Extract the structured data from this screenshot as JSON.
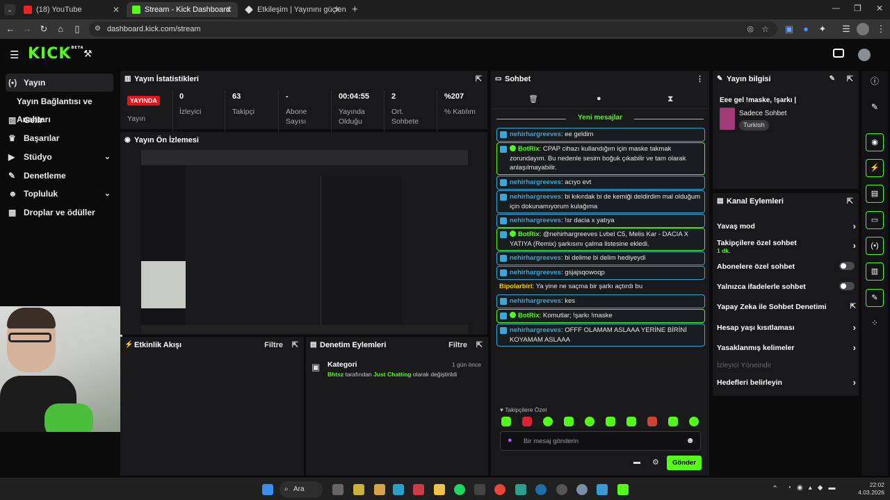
{
  "browser": {
    "tabs": [
      {
        "title": "(18) YouTube"
      },
      {
        "title": "Stream - Kick Dashboard"
      },
      {
        "title": "Etkileşim | Yayınını güçlendi"
      }
    ],
    "url": "dashboard.kick.com/stream",
    "new_tab": "+"
  },
  "kick": {
    "logo": "KICK",
    "logo_beta": "BETA"
  },
  "sidebar": {
    "items": [
      {
        "label": "Yayın",
        "icon": "broadcast-icon"
      },
      {
        "label": "Yayın Bağlantısı ve Anahtarı",
        "icon": ""
      },
      {
        "label": "Gelir",
        "icon": "chart-icon"
      },
      {
        "label": "Başarılar",
        "icon": "trophy-icon"
      },
      {
        "label": "Stüdyo",
        "icon": "video-icon"
      },
      {
        "label": "Denetleme",
        "icon": "wrench-icon"
      },
      {
        "label": "Topluluk",
        "icon": "users-icon"
      },
      {
        "label": "Droplar ve ödüller",
        "icon": "gift-icon"
      }
    ]
  },
  "stats": {
    "title": "Yayın İstatistikleri",
    "live_badge": "YAYINDA",
    "live_label": "Yayın",
    "items": [
      {
        "value": "0",
        "label": "İzleyici"
      },
      {
        "value": "63",
        "label": "Takipçi"
      },
      {
        "value": "-",
        "label": "Abone Sayısı"
      },
      {
        "value": "00:04:55",
        "label": "Yayında Olduğu"
      },
      {
        "value": "2",
        "label": "Ort. Sohbete"
      },
      {
        "value": "%207",
        "label": "% Katılım"
      }
    ]
  },
  "preview": {
    "title": "Yayın Ön İzlemesi"
  },
  "activity": {
    "title": "Etkinlik Akışı",
    "filter": "Filtre"
  },
  "moderation": {
    "title": "Denetim Eylemleri",
    "filter": "Filtre",
    "entry_title": "Kategori",
    "entry_time": "1 gün önce",
    "entry_user": "Bhtsz",
    "entry_mid": " tarafından ",
    "entry_category": "Just Chatting",
    "entry_end": " olarak değiştirildi"
  },
  "chat": {
    "title": "Sohbet",
    "new_messages": "Yeni mesajlar",
    "messages": [
      {
        "user": "nehirhargreeves",
        "text": "ee geldim"
      },
      {
        "user": "BotRix",
        "text": "CPAP cihazı kullandığım için maske takmak zorundayım. Bu nedenle sesim boğuk çıkabilir ve tam olarak anlaşılmayabilir."
      },
      {
        "user": "nehirhargreeves",
        "text": "acıyo evt"
      },
      {
        "user": "nehirhargreeves",
        "text": "bi kıkırdak bi de kemiği deldirdim mal olduğum için dokunamıyorum kulağıma"
      },
      {
        "user": "nehirhargreeves",
        "text": "!sr dacia x yatıya"
      },
      {
        "user": "BotRix",
        "text": "@nehirhargreeves Lvbel C5, Melis Kar - DACIA X YATIYA (Remix) şarkısını çalma listesine ekledi."
      },
      {
        "user": "nehirhargreeves",
        "text": "bi delime bi delim hediyeydi"
      },
      {
        "user": "nehirhargreeves",
        "text": "gsjajsqowoqp"
      },
      {
        "user": "Bipolarbiri",
        "text": "Ya yine ne saçma bir şarkı açtırdı bu"
      },
      {
        "user": "nehirhargreeves",
        "text": "kes"
      },
      {
        "user": "BotRix",
        "text": "Komutlar; !şarkı !maske"
      },
      {
        "user": "nehirhargreeves",
        "text": "OFFF OLAMAM ASLAAA YERİNE BİRİNİ KOYAMAM ASLAAA"
      }
    ],
    "followers_only": "Takipçilere Özel",
    "input_placeholder": "Bir mesaj gönderin",
    "send": "Gönder"
  },
  "stream_info": {
    "title": "Yayın bilgisi",
    "stream_title": "Eee gel !maske, !şarkı |",
    "category": "Sadece Sohbet",
    "language": "Turkish"
  },
  "channel_actions": {
    "title": "Kanal Eylemleri",
    "items": [
      {
        "label": "Yavaş mod",
        "kind": "chevron"
      },
      {
        "label": "Takipçilere özel sohbet",
        "sub": "1 dk.",
        "kind": "chevron"
      },
      {
        "label": "Abonelere özel sohbet",
        "kind": "toggle"
      },
      {
        "label": "Yalnızca ifadelerle sohbet",
        "kind": "toggle"
      },
      {
        "label": "Yapay Zeka ile Sohbet Denetimi",
        "kind": "external"
      },
      {
        "label": "Hesap yaşı kısıtlaması",
        "kind": "chevron"
      },
      {
        "label": "Yasaklanmış kelimeler",
        "kind": "chevron"
      },
      {
        "label": "İzleyici Yöneindir",
        "kind": "disabled"
      },
      {
        "label": "Hedefleri belirleyin",
        "kind": "chevron"
      }
    ]
  },
  "taskbar": {
    "search": "Ara",
    "time": "22:02",
    "date": "4.03.2026"
  },
  "colors": {
    "brand": "#53fc18",
    "live": "#e5131a",
    "user": "#3aa7d9"
  }
}
